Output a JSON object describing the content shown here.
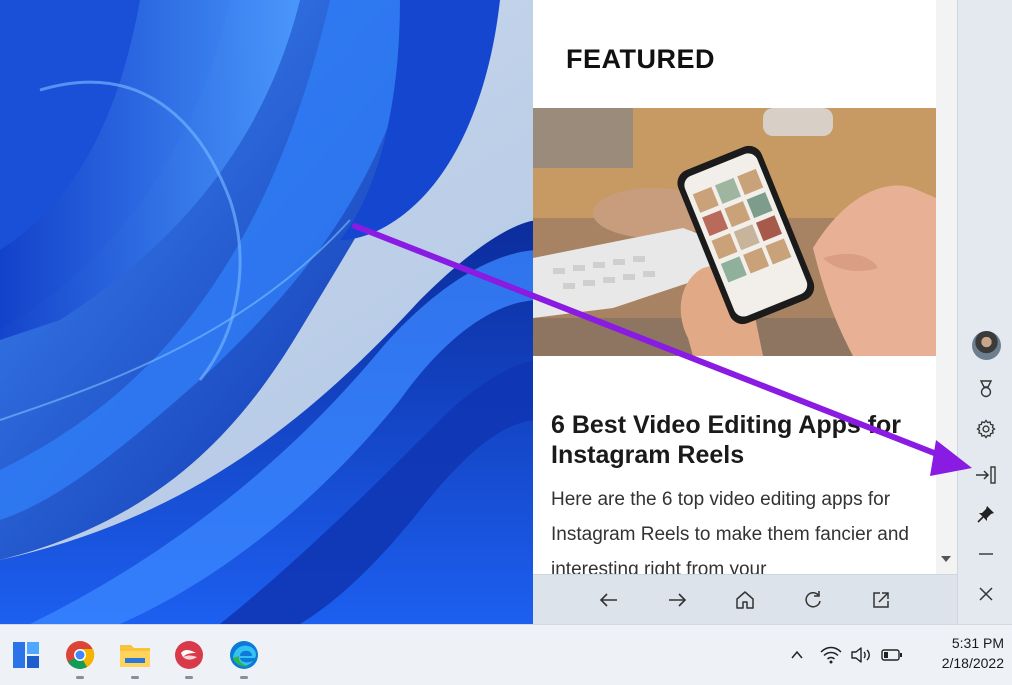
{
  "sidebar_panel": {
    "featured_heading": "FEATURED",
    "featured_image_alt": "hands-holding-phone-image",
    "article_title": "6 Best Video Editing Apps for Instagram Reels",
    "article_excerpt": "Here are the 6 top video editing apps for Instagram Reels to make them fancier and interesting right from your",
    "navbar": [
      "back-arrow-icon",
      "forward-arrow-icon",
      "home-icon",
      "refresh-icon",
      "open-in-new-icon"
    ]
  },
  "side_toolbar": {
    "items": [
      "avatar",
      "rewards-icon",
      "settings-icon",
      "pin-to-side-icon",
      "pin-icon",
      "minimize-icon",
      "close-icon"
    ]
  },
  "taskbar": {
    "apps": [
      "widgets-icon",
      "chrome-icon",
      "file-explorer-icon",
      "swiftkey-icon",
      "edge-icon"
    ],
    "tray": [
      "chevron-up-icon",
      "wifi-icon",
      "volume-icon",
      "battery-icon"
    ],
    "clock": {
      "time": "5:31 PM",
      "date": "2/18/2022"
    }
  },
  "colors": {
    "accent": "#8a1be2",
    "taskbar": "#eef1f6",
    "toolbar": "#e4e9ef",
    "wallpaper_blue": "#1a4fd0"
  }
}
